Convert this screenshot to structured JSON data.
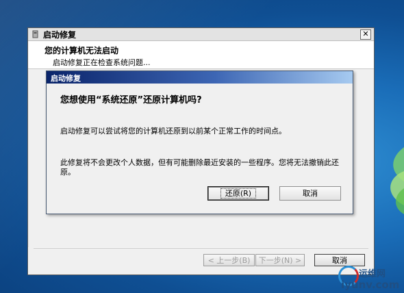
{
  "outer_dialog": {
    "title": "启动修复",
    "header_title": "您的计算机无法启动",
    "header_status": "启动修复正在检查系统问题...",
    "close_glyph": "✕",
    "buttons": {
      "back": "< 上一步(B)",
      "next": "下一步(N) >",
      "cancel": "取消"
    }
  },
  "modal": {
    "title": "启动修复",
    "question": "您想使用“系统还原”还原计算机吗?",
    "paragraph1": "启动修复可以尝试将您的计算机还原到以前某个正常工作的时间点。",
    "paragraph2": "此修复将不会更改个人数据，但有可能删除最近安装的一些程序。您将无法撤销此还原。",
    "buttons": {
      "restore": "还原(R)",
      "cancel": "取消"
    }
  },
  "watermark": {
    "brand": "运维网",
    "domain": "iyunv.com"
  },
  "colors": {
    "desktop": "#1a6db8",
    "modal_title_start": "#0a246a",
    "modal_title_end": "#a6caf0"
  }
}
